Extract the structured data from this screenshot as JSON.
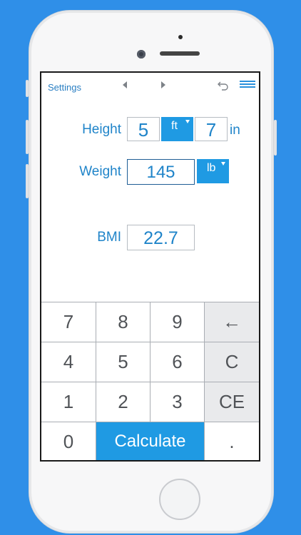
{
  "toolbar": {
    "settings_label": "Settings",
    "prev_icon": "chevron-left-icon",
    "next_icon": "chevron-right-icon",
    "undo_icon": "undo-icon",
    "menu_icon": "hamburger-menu-icon"
  },
  "form": {
    "height_label": "Height",
    "height_feet": "5",
    "height_feet_unit": "ft",
    "height_inches": "7",
    "height_inches_unit": "in",
    "weight_label": "Weight",
    "weight_value": "145",
    "weight_unit": "lb",
    "bmi_label": "BMI",
    "bmi_value": "22.7"
  },
  "keypad": {
    "k7": "7",
    "k8": "8",
    "k9": "9",
    "backspace": "←",
    "k4": "4",
    "k5": "5",
    "k6": "6",
    "clear": "C",
    "k1": "1",
    "k2": "2",
    "k3": "3",
    "clear_entry": "CE",
    "k0": "0",
    "calculate": "Calculate",
    "decimal": "."
  },
  "colors": {
    "background": "#2f8fe8",
    "accent": "#1f9ae3",
    "text_blue": "#1f84c9"
  }
}
